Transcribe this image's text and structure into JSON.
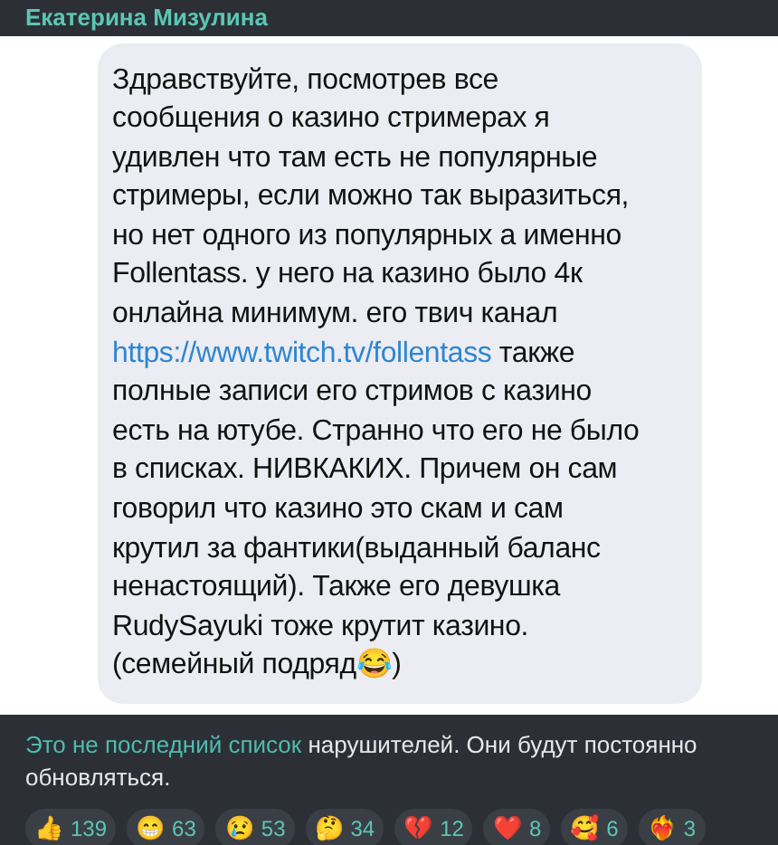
{
  "header": {
    "title": "Екатерина Мизулина"
  },
  "message": {
    "lines": [
      [
        {
          "kind": "text",
          "text": "Здравствуйте, посмотрев все"
        }
      ],
      [
        {
          "kind": "text",
          "text": "сообщения о казино стримерах я"
        }
      ],
      [
        {
          "kind": "text",
          "text": "удивлен что там есть не популярные"
        }
      ],
      [
        {
          "kind": "text",
          "text": "стримеры, если можно так выразиться,"
        }
      ],
      [
        {
          "kind": "text",
          "text": "но нет одного из популярных а именно"
        }
      ],
      [
        {
          "kind": "text",
          "text": "Follentass. у него на казино было 4к"
        }
      ],
      [
        {
          "kind": "text",
          "text": "онлайна минимум. его твич канал"
        }
      ],
      [
        {
          "kind": "link",
          "text": "https://www.twitch.tv/follentass"
        },
        {
          "kind": "text",
          "text": " также"
        }
      ],
      [
        {
          "kind": "text",
          "text": "полные записи его стримов с казино"
        }
      ],
      [
        {
          "kind": "text",
          "text": "есть на ютубе. Странно что его не было"
        }
      ],
      [
        {
          "kind": "text",
          "text": "в списках. НИВКАКИХ. Причем он сам"
        }
      ],
      [
        {
          "kind": "text",
          "text": "говорил что казино это скам и сам"
        }
      ],
      [
        {
          "kind": "text",
          "text": "крутил за фантики(выданный баланс"
        }
      ],
      [
        {
          "kind": "text",
          "text": "ненастоящий). Также его девушка"
        }
      ],
      [
        {
          "kind": "text",
          "text": "RudySayuki тоже крутит казино."
        }
      ],
      [
        {
          "kind": "text",
          "text": "(семейный подряд😂)"
        }
      ]
    ]
  },
  "caption": [
    {
      "kind": "link",
      "text": "Это не последний список"
    },
    {
      "kind": "text",
      "text": " нарушителей. Они будут постоянно обновляться."
    }
  ],
  "reactions": [
    {
      "emoji": "👍",
      "count": "139"
    },
    {
      "emoji": "😁",
      "count": "63"
    },
    {
      "emoji": "😢",
      "count": "53"
    },
    {
      "emoji": "🤔",
      "count": "34"
    },
    {
      "emoji": "💔",
      "count": "12"
    },
    {
      "emoji": "❤️",
      "count": "8"
    },
    {
      "emoji": "🥰",
      "count": "6"
    },
    {
      "emoji": "❤️‍🔥",
      "count": "3"
    }
  ]
}
